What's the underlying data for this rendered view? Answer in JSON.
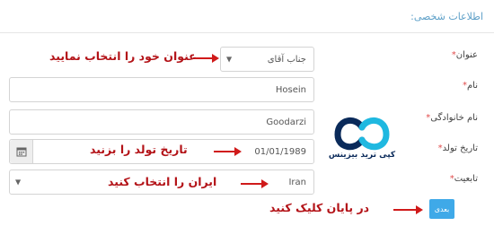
{
  "section": {
    "title": "اطلاعات شخصی:"
  },
  "fields": {
    "title": {
      "label": "عنوان",
      "value": "جناب آقای",
      "annotation": "عنوان خود را انتخاب نمایید"
    },
    "first_name": {
      "label": "نام",
      "value": "Hosein"
    },
    "last_name": {
      "label": "نام خانوادگی",
      "value": "Goodarzi"
    },
    "birth_date": {
      "label": "تاریخ تولد",
      "value": "01/01/1989",
      "annotation": "تاریخ تولد را بزنید"
    },
    "nationality": {
      "label": "تابعیت",
      "value": "Iran",
      "annotation": "ایران را انتخاب کنید"
    }
  },
  "required_marker": "*",
  "next": {
    "label": "بعدی",
    "annotation": "در پایان کلیک کنید"
  },
  "logo": {
    "text": "کپی ترید بیزینس"
  },
  "colors": {
    "accent": "#3fa9e8",
    "annotation": "#b31217",
    "arrow": "#d01a1a",
    "required": "#e14c4c"
  }
}
